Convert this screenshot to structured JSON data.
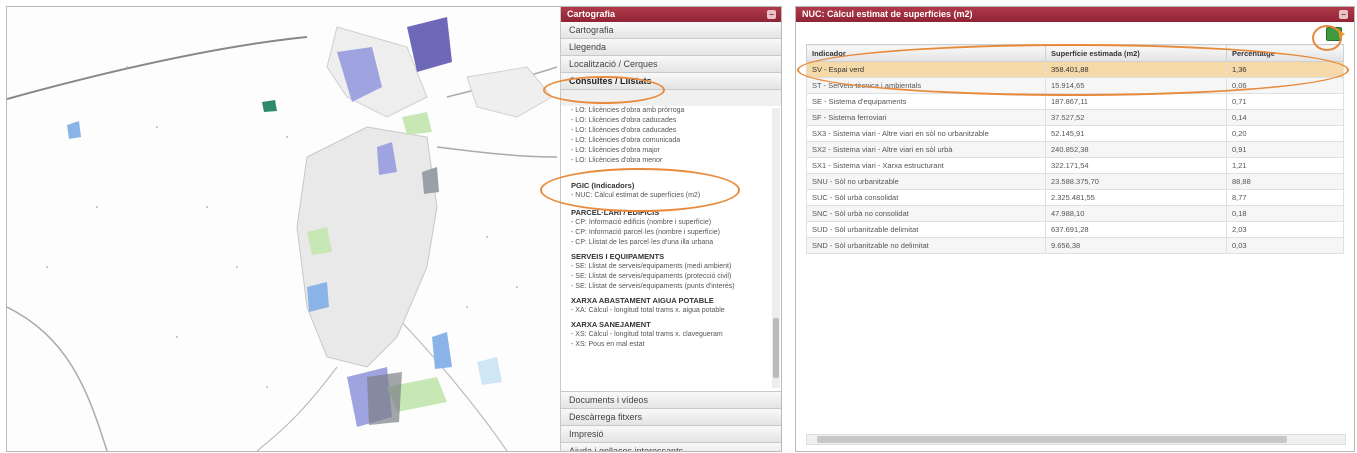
{
  "left_panel": {
    "header": "Cartografia",
    "sections_top": [
      "Cartografia",
      "Llegenda",
      "Localització / Cerques",
      "Consultes / Llistats"
    ],
    "query_groups": [
      {
        "title": "",
        "items": [
          "- LO: Llicències d'obra amb pròrroga",
          "- LO: Llicències d'obra caducades",
          "- LO: Llicències d'obra caducades",
          "- LO: Llicències d'obra comunicada",
          "- LO: Llicències d'obra major",
          "- LO: Llicències d'obra menor"
        ]
      },
      {
        "title": "PGIC (Indicadors)",
        "items": [
          "- NUC: Càlcul estimat de superfícies (m2)"
        ]
      },
      {
        "title": "PARCEL·LARI / EDIFICIS",
        "items": [
          "- CP: Informació edificis (nombre i superfície)",
          "- CP: Informació parcel·les (nombre i superfície)",
          "- CP: Llistat de les parcel·les d'una illa urbana"
        ]
      },
      {
        "title": "SERVEIS I EQUIPAMENTS",
        "items": [
          "- SE: Llistat de serveis/equipaments (medi ambient)",
          "- SE: Llistat de serveis/equipaments (protecció civil)",
          "- SE: Llistat de serveis/equipaments (punts d'interès)"
        ]
      },
      {
        "title": "XARXA ABASTAMENT AIGUA POTABLE",
        "items": [
          "- XA: Càlcul - longitud total trams x. aigua potable"
        ]
      },
      {
        "title": "XARXA SANEJAMENT",
        "items": [
          "- XS: Càlcul - longitud total trams x. clavegueram",
          "- XS: Pous en mal estat"
        ]
      }
    ],
    "sections_bottom": [
      "Documents i vídeos",
      "Descàrrega fitxers",
      "Impresió",
      "Ajuda i enllaços interessants"
    ]
  },
  "right_panel": {
    "header": "NUC: Càlcul estimat de superfícies (m2)",
    "columns": [
      "Indicador",
      "Superfície estimada (m2)",
      "Percentatge"
    ],
    "rows": [
      [
        "SV - Espai verd",
        "358.401,88",
        "1,36"
      ],
      [
        "ST - Serveis tècnica i ambientals",
        "15.914,65",
        "0,06"
      ],
      [
        "SE - Sistema d'equipaments",
        "187.867,11",
        "0,71"
      ],
      [
        "SF - Sistema ferroviari",
        "37.527,52",
        "0,14"
      ],
      [
        "SX3 - Sistema viari - Altre viari en sòl no urbanitzable",
        "52.145,91",
        "0,20"
      ],
      [
        "SX2 - Sistema viari - Altre viari en sòl urbà",
        "240.852,38",
        "0,91"
      ],
      [
        "SX1 - Sistema viari - Xarxa estructurant",
        "322.171,54",
        "1,21"
      ],
      [
        "SNU - Sòl no urbanitzable",
        "23.588.375,70",
        "88,88"
      ],
      [
        "SUC - Sòl urbà consolidat",
        "2.325.481,55",
        "8,77"
      ],
      [
        "SNC - Sòl urbà no consolidat",
        "47.988,10",
        "0,18"
      ],
      [
        "SUD - Sòl urbanitzable delimitat",
        "637.691,28",
        "2,03"
      ],
      [
        "SND - Sòl urbanitzable no delimitat",
        "9.656,38",
        "0,03"
      ]
    ]
  },
  "colors": {
    "header": "#9c2c3c",
    "highlight_oval": "#e88a3c",
    "selected_row": "#f5d9a8"
  }
}
